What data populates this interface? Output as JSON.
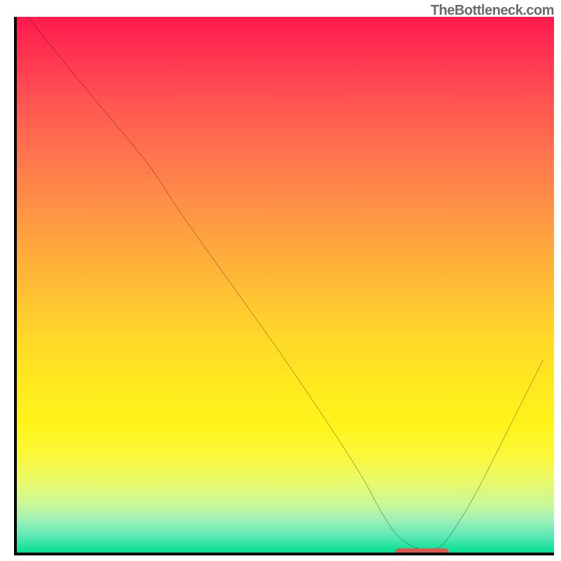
{
  "watermark": "TheBottleneck.com",
  "chart_data": {
    "type": "line",
    "title": "",
    "xlabel": "",
    "ylabel": "",
    "xlim": [
      0,
      100
    ],
    "ylim": [
      0,
      100
    ],
    "series": [
      {
        "name": "bottleneck-curve",
        "x": [
          2,
          10,
          20,
          25,
          30,
          40,
          50,
          60,
          65,
          67,
          70,
          72,
          75,
          78,
          80,
          85,
          90,
          98
        ],
        "values": [
          100,
          90,
          78,
          72,
          64,
          50,
          36,
          21,
          13,
          9,
          4,
          2,
          0.5,
          0.5,
          2,
          10,
          20,
          36
        ]
      }
    ],
    "minimum_marker": {
      "x_start": 70,
      "x_end": 80,
      "y": 0.5
    },
    "background_gradient": {
      "top_color": "#ff1a4d",
      "mid_color": "#ffd828",
      "bottom_color": "#00e090"
    }
  }
}
